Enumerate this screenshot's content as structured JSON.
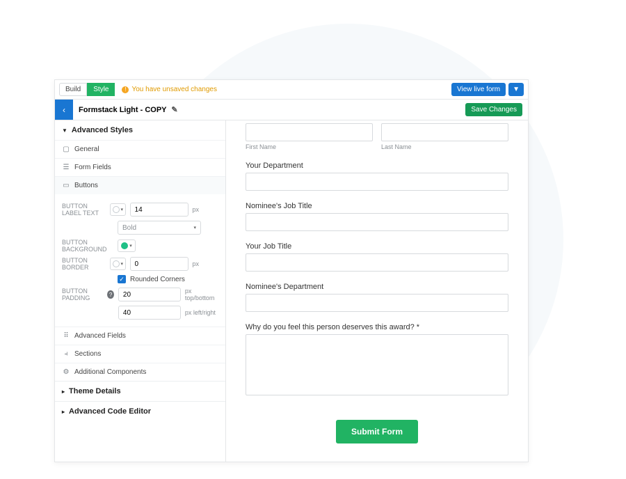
{
  "topbar": {
    "tabs": {
      "build": "Build",
      "style": "Style"
    },
    "warning": "You have unsaved changes",
    "view_live": "View live form",
    "dropdown_glyph": "▼"
  },
  "subheader": {
    "back_glyph": "‹",
    "theme_name": "Formstack Light - COPY",
    "save": "Save Changes"
  },
  "sidebar": {
    "advanced_styles": "Advanced Styles",
    "general": "General",
    "form_fields": "Form Fields",
    "buttons": "Buttons",
    "advanced_fields": "Advanced Fields",
    "sections": "Sections",
    "additional_components": "Additional Components",
    "theme_details": "Theme Details",
    "advanced_code_editor": "Advanced Code Editor"
  },
  "controls": {
    "label_text": "BUTTON LABEL TEXT",
    "label_text_size": "14",
    "label_text_unit": "px",
    "weight": "Bold",
    "background": "BUTTON BACKGROUND",
    "border": "BUTTON BORDER",
    "border_size": "0",
    "border_unit": "px",
    "rounded": "Rounded Corners",
    "padding": "BUTTON PADDING",
    "padding_tb": "20",
    "padding_tb_unit": "px top/bottom",
    "padding_lr": "40",
    "padding_lr_unit": "px left/right"
  },
  "form": {
    "first_name": "First Name",
    "last_name": "Last Name",
    "your_department": "Your Department",
    "nominee_job_title": "Nominee's Job Title",
    "your_job_title": "Your Job Title",
    "nominee_department": "Nominee's Department",
    "award_q": "Why do you feel this person deserves this award? *",
    "submit": "Submit Form"
  }
}
